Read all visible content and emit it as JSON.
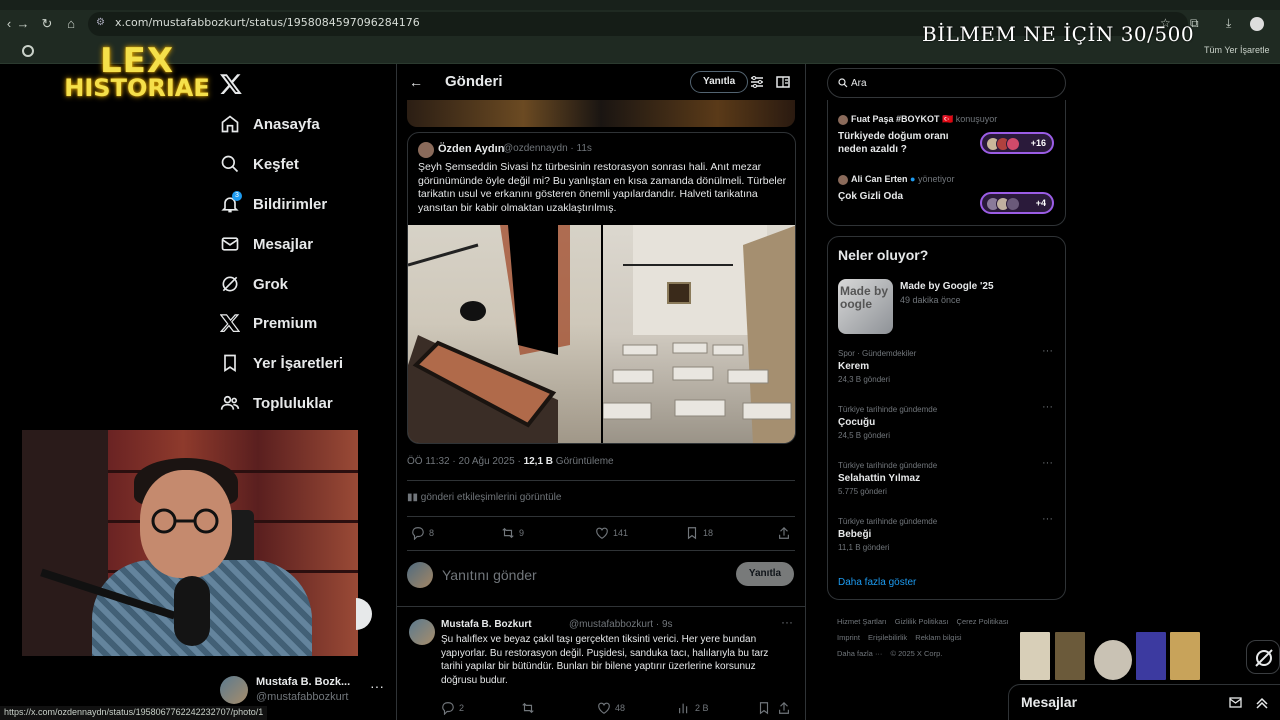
{
  "browser": {
    "url": "x.com/mustafabbozkurt/status/1958084597096284176",
    "bookmarks_all_label": "Tüm Yer İşaretle",
    "status_url": "https://x.com/ozdennaydn/status/1958067762242232707/photo/1"
  },
  "overlay": {
    "banner_text": "BİLMEM NE İÇİN 30/500",
    "logo_line1": "LEX",
    "logo_line2": "HISTORIAE"
  },
  "nav": {
    "items": [
      {
        "label": "Anasayfa",
        "icon": "home-icon"
      },
      {
        "label": "Keşfet",
        "icon": "search-icon"
      },
      {
        "label": "Bildirimler",
        "icon": "bell-icon",
        "badge": "3"
      },
      {
        "label": "Mesajlar",
        "icon": "mail-icon"
      },
      {
        "label": "Grok",
        "icon": "grok-icon"
      },
      {
        "label": "Premium",
        "icon": "x-icon"
      },
      {
        "label": "Yer İşaretleri",
        "icon": "bookmark-icon"
      },
      {
        "label": "Topluluklar",
        "icon": "people-icon"
      }
    ],
    "account": {
      "name": "Mustafa B. Bozk...",
      "handle": "@mustafabbozkurt"
    }
  },
  "main": {
    "title": "Gönderi",
    "reply_pill": "Yanıtla",
    "quote": {
      "name": "Özden Aydın",
      "handle": "@ozdennaydn · 11s",
      "text": "Şeyh Şemseddin Sivasi hz türbesinin restorasyon sonrası hali. Anıt mezar görünümünde öyle değil mi? Bu yanlıştan en kısa zamanda dönülmeli. Türbeler tarikatın usul ve erkanını gösteren önemli yapılardandır. Halveti tarikatına yansıtan bir kabir olmaktan uzaklaştırılmış."
    },
    "meta": {
      "time": "ÖÖ 11:32 · 20 Ağu 2025 · ",
      "views": "12,1 B",
      "views_label": " Görüntüleme"
    },
    "analytics": "gönderi etkileşimlerini görüntüle",
    "actions": {
      "replies": "8",
      "reposts": "9",
      "likes": "141",
      "bookmarks": "18"
    },
    "compose": {
      "placeholder": "Yanıtını gönder",
      "button": "Yanıtla"
    },
    "reply": {
      "name": "Mustafa B. Bozkurt",
      "handle": "@mustafabbozkurt · 9s",
      "text": "Şu halıflex ve beyaz çakıl taşı gerçekten tiksinti verici. Her yere bundan yapıyorlar. Bu restorasyon değil. Puşidesi, sanduka tacı, halılarıyla bu tarz tarihi yapılar bir bütündür. Bunları bir bilene yaptırır üzerlerine korsunuz doğrusu budur.",
      "replies": "2",
      "likes": "48",
      "views": "2 B"
    }
  },
  "sidebar": {
    "search_placeholder": "Ara",
    "spaces": [
      {
        "host": "Fuat Paşa #BOYKOT 🇹🇷",
        "role": "konuşuyor",
        "title": "Türkiyede doğum oranı neden azaldı ?",
        "count": "+16"
      },
      {
        "host": "Ali Can Erten",
        "role": "yönetiyor",
        "title": "Çok Gizli Oda",
        "count": "+4"
      }
    ],
    "trends_title": "Neler oluyor?",
    "featured": {
      "title": "Made by Google '25",
      "sub": "49 dakika önce",
      "img_text": "Made by oogle"
    },
    "trends": [
      {
        "category": "Spor · Gündemdekiler",
        "name": "Kerem",
        "count": "24,3 B gönderi"
      },
      {
        "category": "Türkiye tarihinde gündemde",
        "name": "Çocuğu",
        "count": "24,5 B gönderi"
      },
      {
        "category": "Türkiye tarihinde gündemde",
        "name": "Selahattin Yılmaz",
        "count": "5.775 gönderi"
      },
      {
        "category": "Türkiye tarihinde gündemde",
        "name": "Bebeği",
        "count": "11,1 B gönderi"
      }
    ],
    "show_more": "Daha fazla göster",
    "footer": [
      "Hizmet Şartları",
      "Gizlilik Politikası",
      "Çerez Politikası",
      "Imprint",
      "Erişilebilirlik",
      "Reklam bilgisi",
      "Daha fazla ···",
      "© 2025 X Corp."
    ],
    "messages_label": "Mesajlar"
  }
}
